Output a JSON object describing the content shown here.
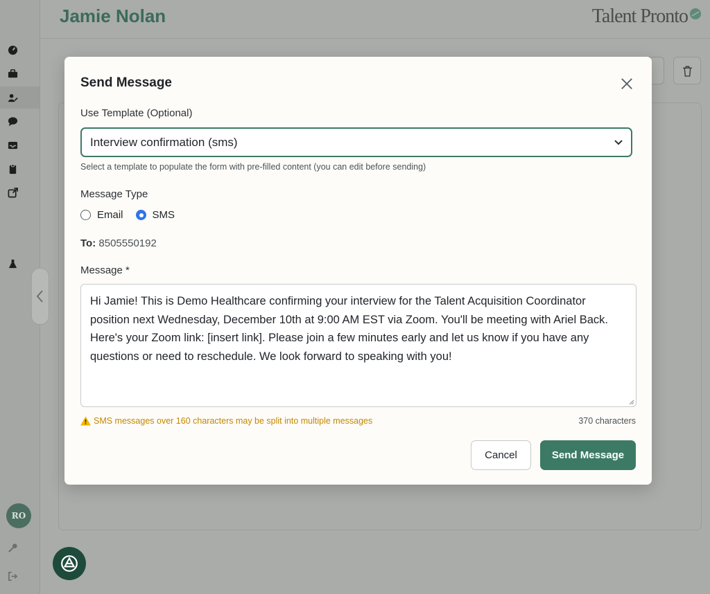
{
  "app": {
    "candidate_name": "Jamie Nolan",
    "brand": "Talent Pronto",
    "user_initials": "RO"
  },
  "sidebar": {
    "icons": [
      "dashboard-icon",
      "briefcase-icon",
      "candidate-edit-icon",
      "chat-bubble-icon",
      "inbox-icon",
      "clipboard-icon",
      "external-link-icon",
      "flask-icon",
      "key-icon",
      "logout-icon"
    ]
  },
  "modal": {
    "title": "Send Message",
    "template_label": "Use Template (Optional)",
    "template_value": "Interview confirmation (sms)",
    "template_hint": "Select a template to populate the form with pre-filled content (you can edit before sending)",
    "message_type_label": "Message Type",
    "message_types": [
      "Email",
      "SMS"
    ],
    "selected_type": "SMS",
    "to_label": "To:",
    "to_value": "8505550192",
    "message_label": "Message *",
    "message_body": "Hi Jamie! This is Demo Healthcare confirming your interview for the Talent Acquisition Coordinator position next Wednesday, December 10th at 9:00 AM EST via Zoom. You'll be meeting with Ariel Back. Here's your Zoom link: [insert link]. Please join a few minutes early and let us know if you have any questions or need to reschedule. We look forward to speaking with you!",
    "sms_warning": "SMS messages over 160 characters may be split into multiple messages",
    "char_count": "370 characters",
    "cancel_label": "Cancel",
    "send_label": "Send Message"
  },
  "colors": {
    "accent": "#3d7a66",
    "radio_selected": "#2f74e8",
    "warning": "#c48700"
  }
}
